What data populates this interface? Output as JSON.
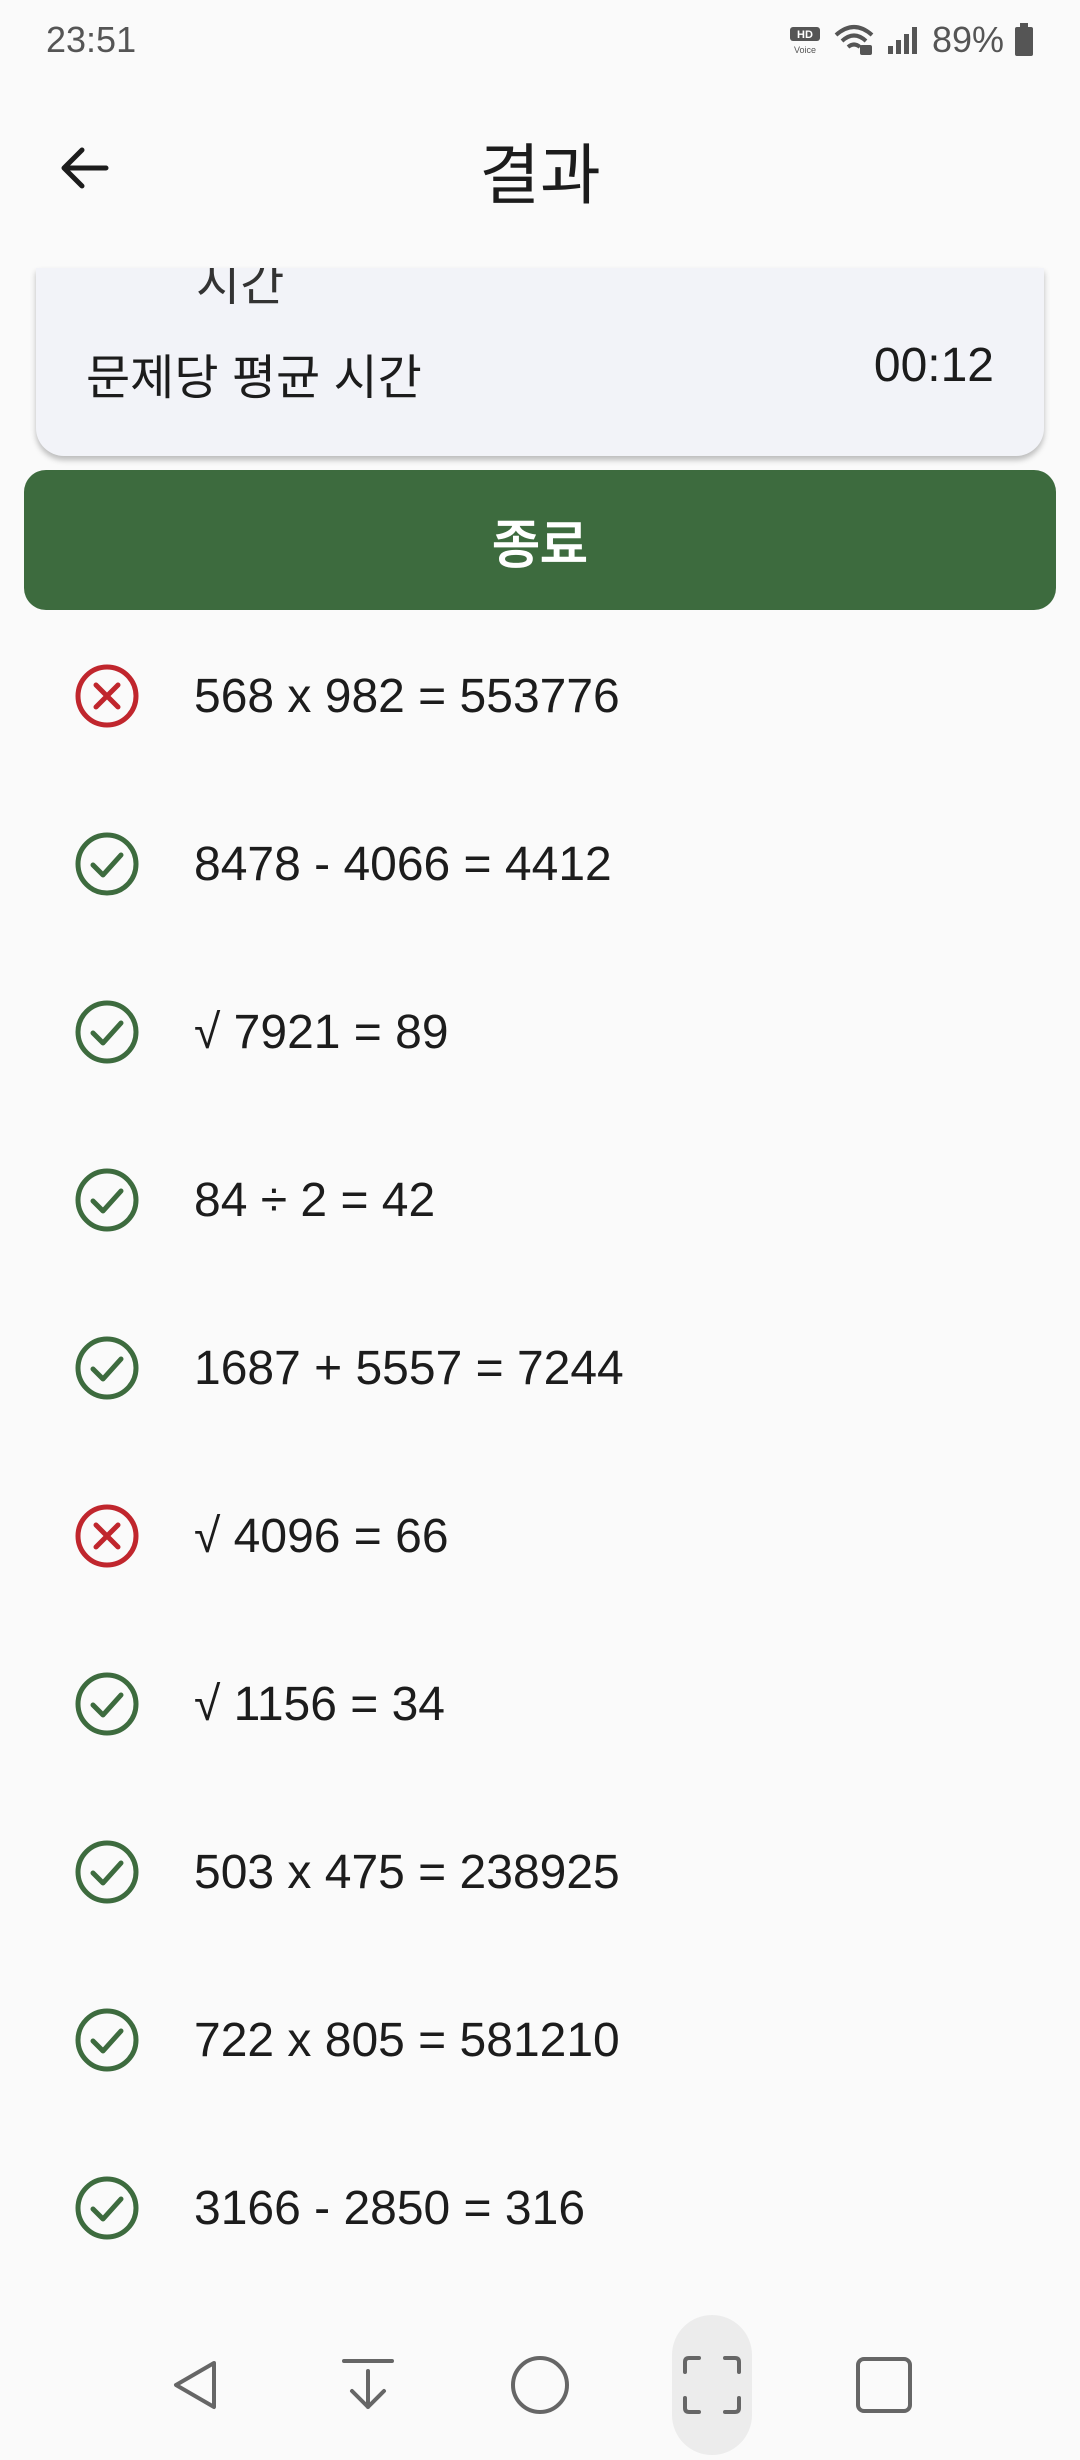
{
  "status_bar": {
    "time": "23:51",
    "hd_voice": "HD",
    "hd_voice_sub": "Voice",
    "battery": "89%"
  },
  "header": {
    "title": "결과"
  },
  "summary": {
    "partial_text": "시간",
    "avg_label": "문제당 평균 시간",
    "avg_value": "00:12"
  },
  "end_button": {
    "label": "종료"
  },
  "results": [
    {
      "expression": "568 x 982 = 553776",
      "correct": false
    },
    {
      "expression": "8478 - 4066 = 4412",
      "correct": true
    },
    {
      "expression": "√ 7921 = 89",
      "correct": true
    },
    {
      "expression": "84 ÷ 2 = 42",
      "correct": true
    },
    {
      "expression": "1687 + 5557 = 7244",
      "correct": true
    },
    {
      "expression": "√ 4096 = 66",
      "correct": false
    },
    {
      "expression": "√ 1156 = 34",
      "correct": true
    },
    {
      "expression": "503 x 475 = 238925",
      "correct": true
    },
    {
      "expression": "722 x 805 = 581210",
      "correct": true
    },
    {
      "expression": "3166 - 2850 = 316",
      "correct": true
    }
  ],
  "colors": {
    "correct": "#3d6b3e",
    "wrong": "#c0262d",
    "primary": "#3d6b3e"
  },
  "nav": {
    "items": [
      "back-icon",
      "download-icon",
      "home-icon",
      "screenshot-icon",
      "recents-icon"
    ]
  }
}
